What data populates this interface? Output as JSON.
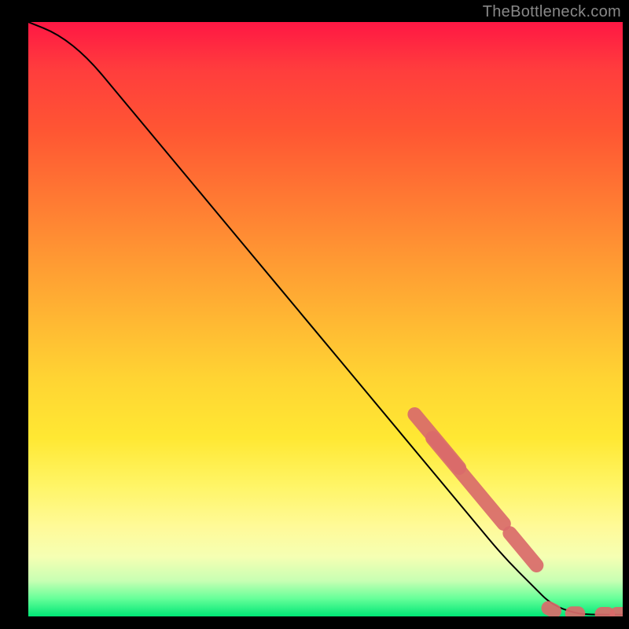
{
  "attribution": "TheBottleneck.com",
  "chart_data": {
    "type": "line",
    "title": "",
    "xlabel": "",
    "ylabel": "",
    "xlim": [
      0,
      100
    ],
    "ylim": [
      0,
      100
    ],
    "curve": {
      "x": [
        0,
        5,
        10,
        15,
        20,
        25,
        30,
        35,
        40,
        45,
        50,
        55,
        60,
        65,
        70,
        75,
        80,
        85,
        88,
        92,
        95,
        100
      ],
      "y": [
        100,
        98,
        94,
        88,
        82,
        76,
        70,
        64,
        58,
        52,
        46,
        40,
        34,
        28,
        22,
        16,
        10,
        5,
        2,
        0.5,
        0.3,
        0.3
      ]
    },
    "highlight_segments": [
      {
        "x": [
          65,
          67.5,
          70,
          72.5
        ],
        "y": [
          34,
          31,
          28,
          25
        ]
      },
      {
        "x": [
          68,
          69.5,
          71,
          72.5,
          74,
          75.5,
          77,
          78.5,
          80
        ],
        "y": [
          30,
          28.2,
          26.4,
          24.6,
          22.8,
          21,
          19.2,
          17.4,
          15.6
        ]
      },
      {
        "x": [
          81,
          82.5,
          84,
          85.5
        ],
        "y": [
          14,
          12.2,
          10.4,
          8.6
        ]
      },
      {
        "x": [
          87.5,
          88.5
        ],
        "y": [
          1.4,
          0.9
        ]
      },
      {
        "x": [
          91.5,
          92.5
        ],
        "y": [
          0.5,
          0.5
        ]
      },
      {
        "x": [
          96.5,
          97.5
        ],
        "y": [
          0.4,
          0.4
        ]
      },
      {
        "x": [
          99,
          100
        ],
        "y": [
          0.4,
          0.4
        ]
      }
    ],
    "colors": {
      "curve": "#000000",
      "highlight_stroke": "#d96a6a",
      "highlight_fill": "#d96a6a"
    }
  }
}
